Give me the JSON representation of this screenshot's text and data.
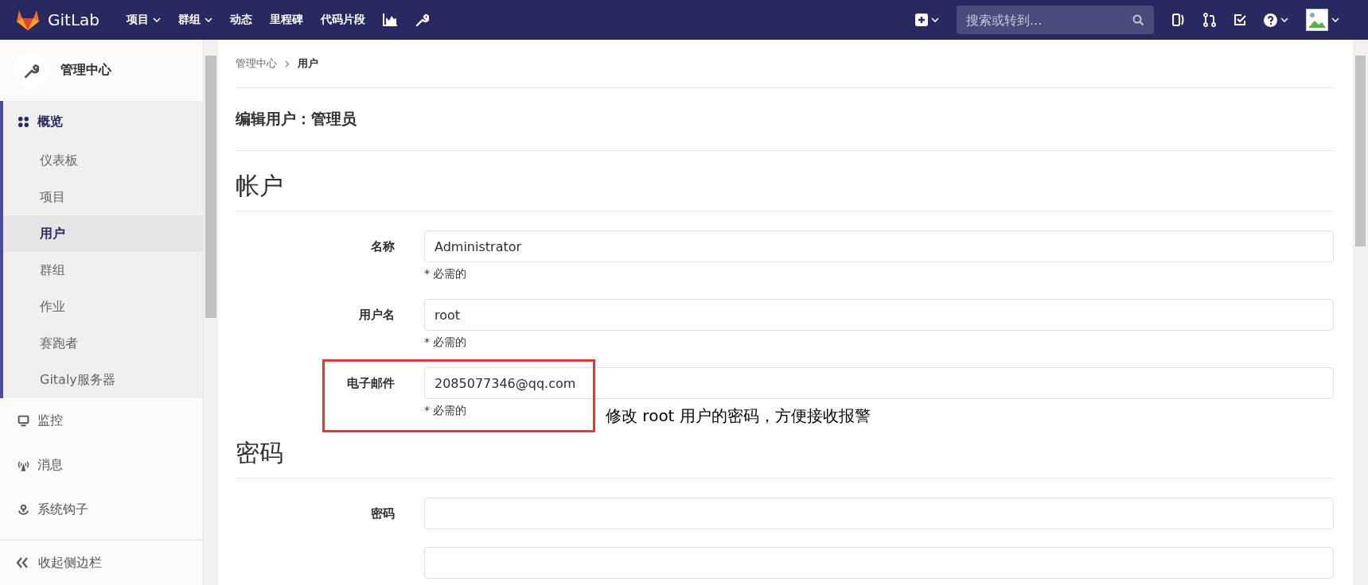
{
  "top_bar": {
    "brand": "GitLab",
    "menu": [
      {
        "label": "项目",
        "dropdown": true
      },
      {
        "label": "群组",
        "dropdown": true
      },
      {
        "label": "动态",
        "dropdown": false
      },
      {
        "label": "里程碑",
        "dropdown": false
      },
      {
        "label": "代码片段",
        "dropdown": false
      }
    ],
    "search": {
      "placeholder": "搜索或转到..."
    }
  },
  "sidebar": {
    "title": "管理中心",
    "groups": [
      {
        "label": "概览",
        "expanded": true,
        "children": [
          {
            "label": "仪表板",
            "selected": false
          },
          {
            "label": "项目",
            "selected": false
          },
          {
            "label": "用户",
            "selected": true
          },
          {
            "label": "群组",
            "selected": false
          },
          {
            "label": "作业",
            "selected": false
          },
          {
            "label": "赛跑者",
            "selected": false
          },
          {
            "label": "Gitaly服务器",
            "selected": false
          }
        ]
      },
      {
        "label": "监控",
        "expanded": false
      },
      {
        "label": "消息",
        "expanded": false
      },
      {
        "label": "系统钩子",
        "expanded": false
      }
    ],
    "collapse": "收起侧边栏"
  },
  "breadcrumb": [
    {
      "label": "管理中心",
      "current": false
    },
    {
      "label": "用户",
      "current": true
    }
  ],
  "page_title": "编辑用户：管理员",
  "sections": [
    {
      "title": "帐户",
      "fields": [
        {
          "label": "名称",
          "value": "Administrator",
          "hint": "* 必需的",
          "highlighted": false
        },
        {
          "label": "用户名",
          "value": "root",
          "hint": "* 必需的",
          "highlighted": false
        },
        {
          "label": "电子邮件",
          "value": "2085077346@qq.com",
          "hint": "* 必需的",
          "highlighted": true,
          "annotation": "修改 root 用户的密码，方便接收报警"
        }
      ]
    },
    {
      "title": "密码",
      "fields": [
        {
          "label": "密码",
          "highlighted": false
        },
        {
          "highlighted": false
        }
      ]
    }
  ]
}
